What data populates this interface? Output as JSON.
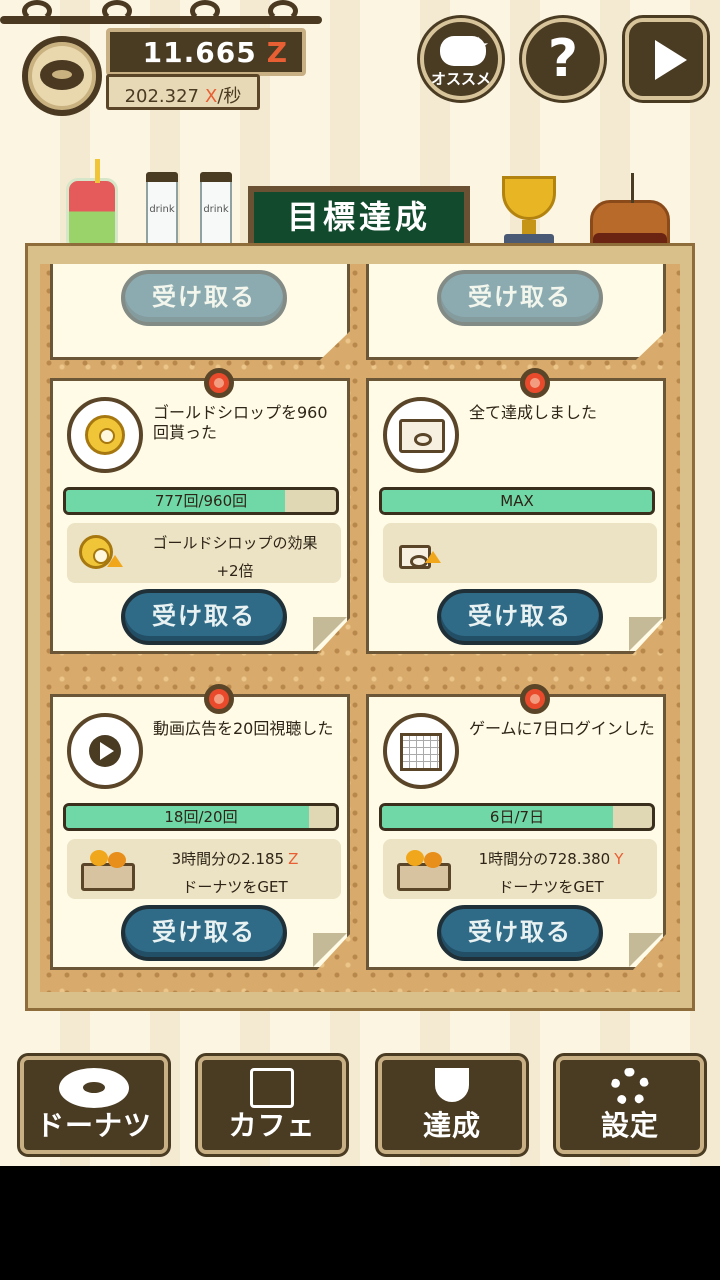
{
  "header": {
    "money_value": "11.665",
    "money_unit": "Z",
    "rate_value": "202.327",
    "rate_unit": "X",
    "rate_suffix": "/秒",
    "osusume_label": "オススメ",
    "help_label": "?"
  },
  "shelf": {
    "bottle_label": "drink",
    "sign_title": "目標達成"
  },
  "receive_label": "受け取る",
  "cards": [
    {
      "title": "ゴールドシロップを960回貰った",
      "progress_text": "777回/960回",
      "progress_fraction": 0.81,
      "reward_line1": "ゴールドシロップの効果",
      "reward_line2": "+2倍"
    },
    {
      "title": "全て達成しました",
      "progress_text": "MAX",
      "progress_fraction": 1.0,
      "reward_line1": "",
      "reward_line2": ""
    },
    {
      "title": "動画広告を20回視聴した",
      "progress_text": "18回/20回",
      "progress_fraction": 0.9,
      "reward_line1": "3時間分の2.185",
      "reward_unit": "Z",
      "reward_line2": "ドーナツをGET"
    },
    {
      "title": "ゲームに7日ログインした",
      "progress_text": "6日/7日",
      "progress_fraction": 0.857,
      "reward_line1": "1時間分の728.380",
      "reward_unit": "Y",
      "reward_line2": "ドーナツをGET"
    }
  ],
  "nav": {
    "donut": "ドーナツ",
    "cafe": "カフェ",
    "achievement": "達成",
    "settings": "設定"
  },
  "colors": {
    "progress_fill": "#6fd8a6",
    "receive_button": "#2f6a86",
    "accent_unit": "#e85f33",
    "dark_brown": "#4a3b23"
  }
}
